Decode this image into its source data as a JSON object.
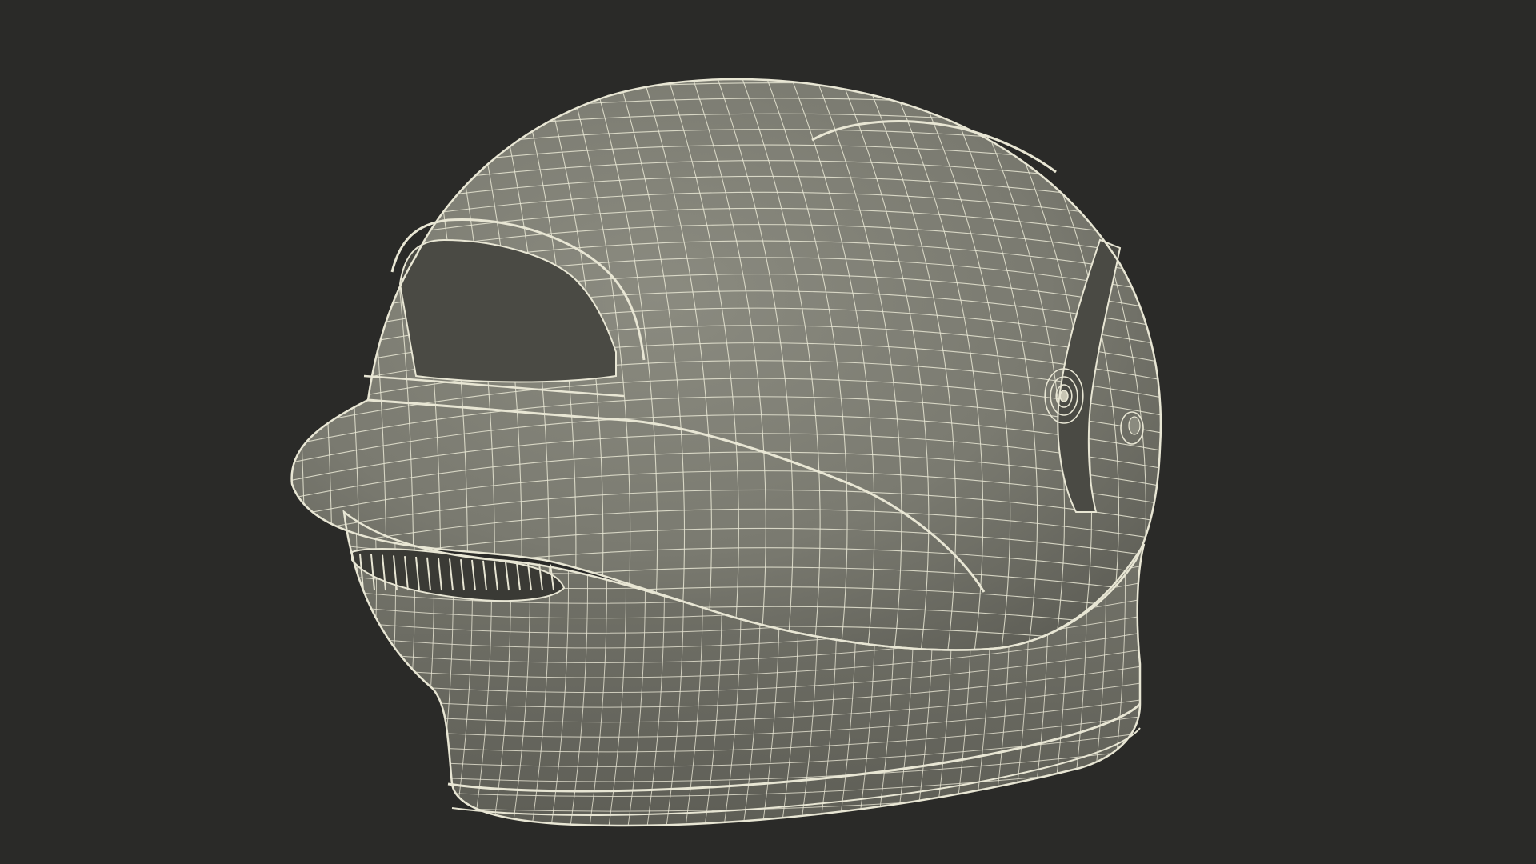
{
  "scene": {
    "subject": "helmet-wireframe-render",
    "colors": {
      "background": "#2a2a28",
      "shell_fill": "#7a7a70",
      "shell_shadow": "#5f5f57",
      "shell_highlight": "#8b8b80",
      "cavity": "#4a4a44",
      "wire": "#e8e6d4",
      "vent_dark": "#3a3a35"
    }
  }
}
